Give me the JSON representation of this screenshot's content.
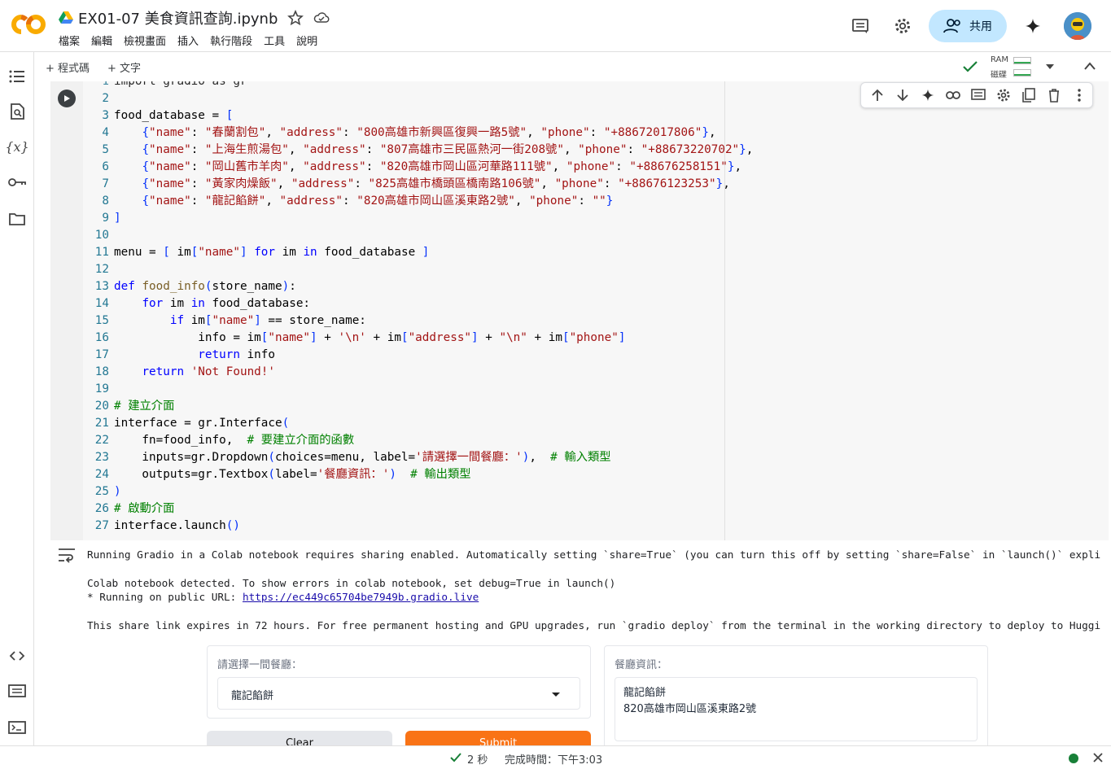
{
  "header": {
    "file_title": "EX01-07 美食資訊查詢.ipynb",
    "menu": [
      "檔案",
      "編輯",
      "檢視畫面",
      "插入",
      "執行階段",
      "工具",
      "說明"
    ],
    "share_label": "共用"
  },
  "toolbar": {
    "add_code": "+ 程式碼",
    "add_text": "+ 文字",
    "ram_label": "RAM",
    "disk_label": "磁碟"
  },
  "code": {
    "first_line_partial": "import gradio as gr",
    "lines": [
      {
        "n": "2",
        "t": ""
      },
      {
        "n": "3",
        "t": "food_database = ["
      },
      {
        "n": "4",
        "t": "    {\"name\": \"春蘭割包\", \"address\": \"800高雄市新興區復興一路5號\", \"phone\": \"+88672017806\"},"
      },
      {
        "n": "5",
        "t": "    {\"name\": \"上海生煎湯包\", \"address\": \"807高雄市三民區熱河一街208號\", \"phone\": \"+88673220702\"},"
      },
      {
        "n": "6",
        "t": "    {\"name\": \"岡山舊市羊肉\", \"address\": \"820高雄市岡山區河華路111號\", \"phone\": \"+88676258151\"},"
      },
      {
        "n": "7",
        "t": "    {\"name\": \"黃家肉燥飯\", \"address\": \"825高雄市橋頭區橋南路106號\", \"phone\": \"+88676123253\"},"
      },
      {
        "n": "8",
        "t": "    {\"name\": \"龍記餡餅\", \"address\": \"820高雄市岡山區溪東路2號\", \"phone\": \"\"}"
      },
      {
        "n": "9",
        "t": "]"
      },
      {
        "n": "10",
        "t": ""
      },
      {
        "n": "11",
        "t": "menu = [ im[\"name\"] for im in food_database ]"
      },
      {
        "n": "12",
        "t": ""
      },
      {
        "n": "13",
        "t": "def food_info(store_name):"
      },
      {
        "n": "14",
        "t": "    for im in food_database:"
      },
      {
        "n": "15",
        "t": "        if im[\"name\"] == store_name:"
      },
      {
        "n": "16",
        "t": "            info = im[\"name\"] + '\\n' + im[\"address\"] + \"\\n\" + im[\"phone\"]"
      },
      {
        "n": "17",
        "t": "            return info"
      },
      {
        "n": "18",
        "t": "    return 'Not Found!'"
      },
      {
        "n": "19",
        "t": ""
      },
      {
        "n": "20",
        "t": "# 建立介面"
      },
      {
        "n": "21",
        "t": "interface = gr.Interface("
      },
      {
        "n": "22",
        "t": "    fn=food_info,  # 要建立介面的函數"
      },
      {
        "n": "23",
        "t": "    inputs=gr.Dropdown(choices=menu, label='請選擇一間餐廳：'),  # 輸入類型"
      },
      {
        "n": "24",
        "t": "    outputs=gr.Textbox(label='餐廳資訊：')  # 輸出類型"
      },
      {
        "n": "25",
        "t": ")"
      },
      {
        "n": "26",
        "t": "# 啟動介面"
      },
      {
        "n": "27",
        "t": "interface.launch()"
      }
    ]
  },
  "output": {
    "line1": "Running Gradio in a Colab notebook requires sharing enabled. Automatically setting `share=True` (you can turn this off by setting `share=False` in `launch()` expli",
    "line2": "Colab notebook detected. To show errors in colab notebook, set debug=True in launch()",
    "line3_prefix": "* Running on public URL: ",
    "line3_link": "https://ec449c65704be7949b.gradio.live",
    "line4": "This share link expires in 72 hours. For free permanent hosting and GPU upgrades, run `gradio deploy` from the terminal in the working directory to deploy to Huggi"
  },
  "gradio": {
    "input_label": "請選擇一間餐廳：",
    "dropdown_value": "龍記餡餅",
    "output_label": "餐廳資訊：",
    "output_value": "龍記餡餅\n820高雄市岡山區溪東路2號",
    "clear_label": "Clear",
    "submit_label": "Submit"
  },
  "status": {
    "duration": "2 秒",
    "completed": "完成時間：下午3:03"
  },
  "colors": {
    "accent_share": "#c2e7ff",
    "submit": "#f97316",
    "status_ok": "#188038"
  }
}
